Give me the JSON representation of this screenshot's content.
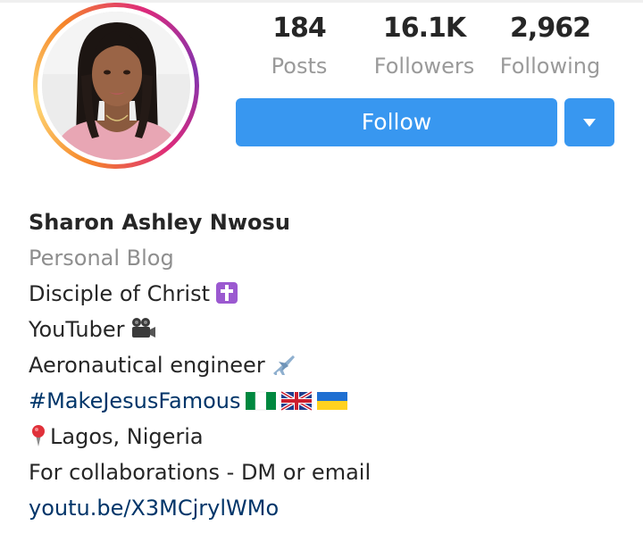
{
  "profile": {
    "stats": [
      {
        "value": "184",
        "label": "Posts"
      },
      {
        "value": "16.1K",
        "label": "Followers"
      },
      {
        "value": "2,962",
        "label": "Following"
      }
    ],
    "follow_label": "Follow",
    "bio": {
      "name": "Sharon Ashley Nwosu",
      "category": "Personal Blog",
      "line1": "Disciple of Christ",
      "line2": "YouTuber",
      "line3": "Aeronautical engineer",
      "hashtag": "#MakeJesusFamous",
      "location": "Lagos, Nigeria",
      "contact": "For collaborations - DM or email",
      "link": "youtu.be/X3MCjrylWMo"
    },
    "icons": {
      "cross": "latin-cross-icon",
      "camera": "movie-camera-icon",
      "plane": "airplane-icon",
      "flags": [
        "nigeria-flag-icon",
        "uk-flag-icon",
        "ukraine-flag-icon"
      ],
      "pin": "location-pin-icon",
      "dropdown": "chevron-down-icon"
    },
    "colors": {
      "accent": "#3897f0",
      "link": "#003569",
      "muted": "#8e8e8e"
    }
  }
}
